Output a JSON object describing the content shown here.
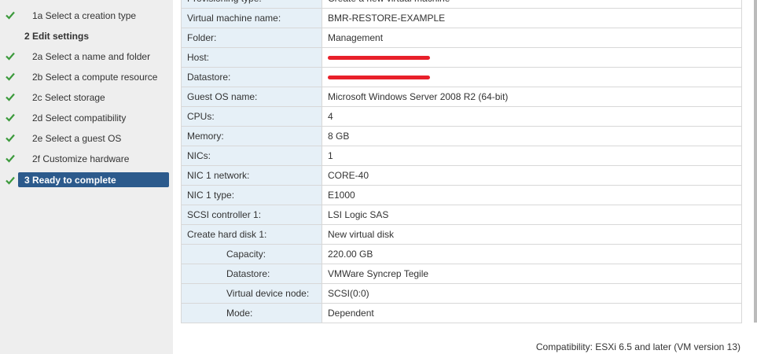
{
  "wizard": {
    "steps": [
      {
        "label": "1a  Select a creation type",
        "check": true,
        "type": "sub"
      },
      {
        "label": "2  Edit settings",
        "check": false,
        "type": "main"
      },
      {
        "label": "2a  Select a name and folder",
        "check": true,
        "type": "sub"
      },
      {
        "label": "2b  Select a compute resource",
        "check": true,
        "type": "sub"
      },
      {
        "label": "2c  Select storage",
        "check": true,
        "type": "sub"
      },
      {
        "label": "2d  Select compatibility",
        "check": true,
        "type": "sub"
      },
      {
        "label": "2e  Select a guest OS",
        "check": true,
        "type": "sub"
      },
      {
        "label": "2f  Customize hardware",
        "check": true,
        "type": "sub"
      },
      {
        "label": "3  Ready to complete",
        "check": true,
        "type": "active"
      }
    ],
    "check_color": "#3c9a3c",
    "active_color": "#2c5a8c"
  },
  "summary": {
    "rows": [
      {
        "key": "Provisioning type:",
        "value": "Create a new virtual machine",
        "indent": false
      },
      {
        "key": "Virtual machine name:",
        "value": "BMR-RESTORE-EXAMPLE",
        "indent": false
      },
      {
        "key": "Folder:",
        "value": "Management",
        "indent": false
      },
      {
        "key": "Host:",
        "value": "",
        "redacted": true,
        "indent": false
      },
      {
        "key": "Datastore:",
        "value": "",
        "redacted": true,
        "indent": false
      },
      {
        "key": "Guest OS name:",
        "value": "Microsoft Windows Server 2008 R2 (64-bit)",
        "indent": false
      },
      {
        "key": "CPUs:",
        "value": "4",
        "indent": false
      },
      {
        "key": "Memory:",
        "value": "8 GB",
        "indent": false
      },
      {
        "key": "NICs:",
        "value": "1",
        "indent": false
      },
      {
        "key": "NIC 1 network:",
        "value": "CORE-40",
        "indent": false
      },
      {
        "key": "NIC 1 type:",
        "value": "E1000",
        "indent": false
      },
      {
        "key": "SCSI controller 1:",
        "value": "LSI Logic SAS",
        "indent": false
      },
      {
        "key": "Create hard disk 1:",
        "value": "New virtual disk",
        "indent": false
      },
      {
        "key": "Capacity:",
        "value": "220.00 GB",
        "indent": true
      },
      {
        "key": "Datastore:",
        "value": "VMWare Syncrep Tegile",
        "indent": true
      },
      {
        "key": "Virtual device node:",
        "value": "SCSI(0:0)",
        "indent": true
      },
      {
        "key": "Mode:",
        "value": "Dependent",
        "indent": true
      }
    ],
    "key_bg": "#e6f0f7",
    "redact_color": "#e8202a"
  },
  "footer": {
    "compatibility": "Compatibility: ESXi 6.5 and later (VM version 13)"
  }
}
